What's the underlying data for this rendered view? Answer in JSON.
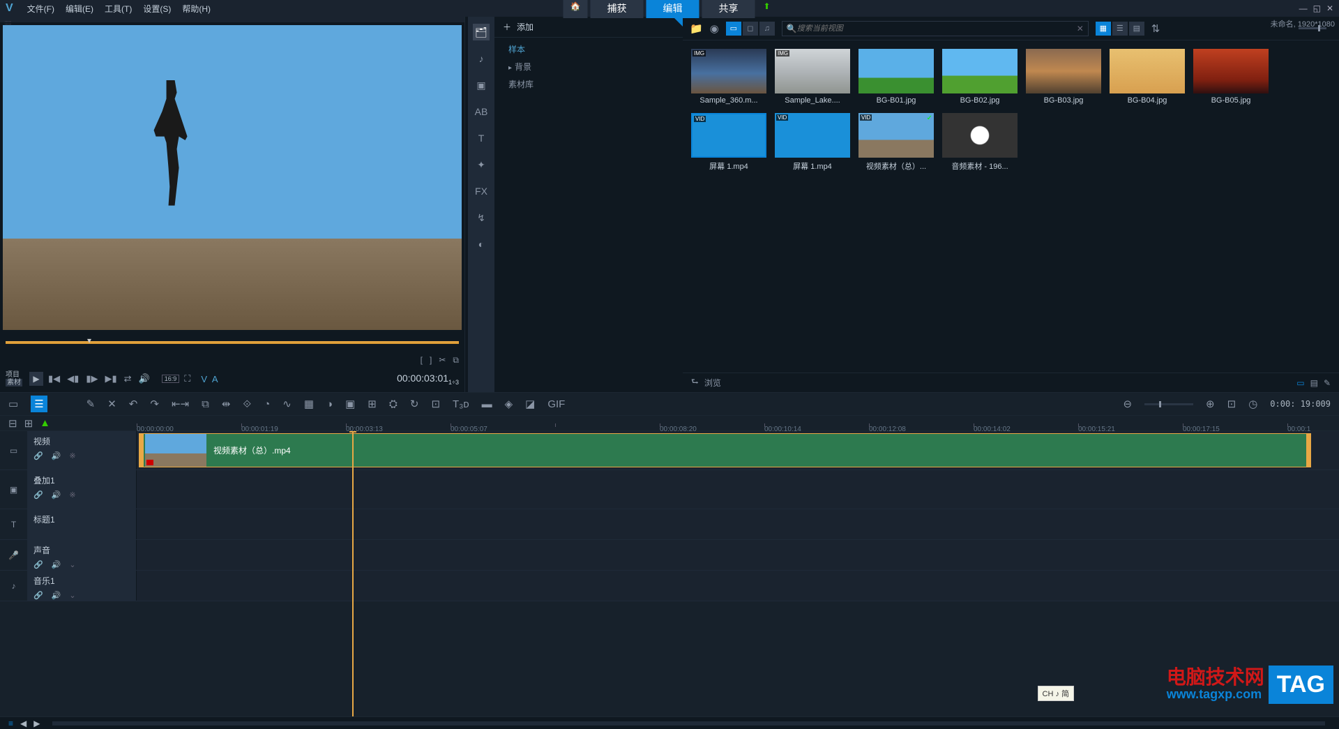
{
  "menu": {
    "file": "文件(F)",
    "edit": "编辑(E)",
    "tools": "工具(T)",
    "settings": "设置(S)",
    "help": "帮助(H)"
  },
  "main_tabs": {
    "capture": "捕获",
    "edit": "编辑",
    "share": "共享"
  },
  "project_status": "未命名, 1920*1080",
  "tree": {
    "add": "添加",
    "sample": "样本",
    "background": "背景",
    "library": "素材库"
  },
  "search": {
    "placeholder": "搜索当前视图"
  },
  "media": [
    {
      "name": "Sample_360.m...",
      "badge": "IMG",
      "bg": "linear-gradient(#2a3a55 0%, #4870a0 55%, #6a5540 100%)"
    },
    {
      "name": "Sample_Lake....",
      "badge": "IMG",
      "bg": "linear-gradient(#d0d5d8 0%, #b0b5b8 50%, #909590 100%)"
    },
    {
      "name": "BG-B01.jpg",
      "badge": "",
      "bg": "linear-gradient(#5ab0e8 0%, #5ab0e8 65%, #3a9030 65%)"
    },
    {
      "name": "BG-B02.jpg",
      "badge": "",
      "bg": "linear-gradient(#60b8f0 0%, #60b8f0 60%, #50a030 60%)"
    },
    {
      "name": "BG-B03.jpg",
      "badge": "",
      "bg": "linear-gradient(#8a6a50 0%, #c08850 50%, #504030 100%)"
    },
    {
      "name": "BG-B04.jpg",
      "badge": "",
      "bg": "linear-gradient(#e8c070 0%, #d8a050 100%)"
    },
    {
      "name": "BG-B05.jpg",
      "badge": "",
      "bg": "linear-gradient(#c04020 0%, #802010 70%, #301010 100%)"
    },
    {
      "name": "屏幕 1.mp4",
      "badge": "VID",
      "bg": "#1a90d9",
      "sel": true
    },
    {
      "name": "屏幕 1.mp4",
      "badge": "VID",
      "bg": "#1a90d9"
    },
    {
      "name": "视频素材（总）...",
      "badge": "VID",
      "bg": "linear-gradient(#5fa8dd 0%, #5fa8dd 60%, #8a7860 60%)",
      "check": true
    },
    {
      "name": "音频素材 - 196...",
      "badge": "",
      "bg": "radial-gradient(circle, #fff 20%, #333 22%, #333 100%)",
      "audio": true
    }
  ],
  "browse": "浏览",
  "preview": {
    "proj": "项目",
    "clip": "素材",
    "timecode_main": "00:00:03:01",
    "timecode_frac": "1÷3"
  },
  "ruler": [
    "00:00:00:00",
    "00:00:01:19",
    "00:00:03:13",
    "00:00:05:07",
    "",
    "00:00:08:20",
    "00:00:10:14",
    "00:00:12:08",
    "00:00:14:02",
    "00:00:15:21",
    "00:00:17:15",
    "00:00:1"
  ],
  "ruler_end": "0:00: 19:009",
  "tracks": {
    "video": "视频",
    "overlay": "叠加1",
    "title": "标题1",
    "voice": "声音",
    "music": "音乐1"
  },
  "clip_name": "视频素材（总）.mp4",
  "ime": "CH ♪ 简",
  "watermark": {
    "line1": "电脑技术网",
    "line2": "www.tagxp.com",
    "tag": "TAG"
  }
}
